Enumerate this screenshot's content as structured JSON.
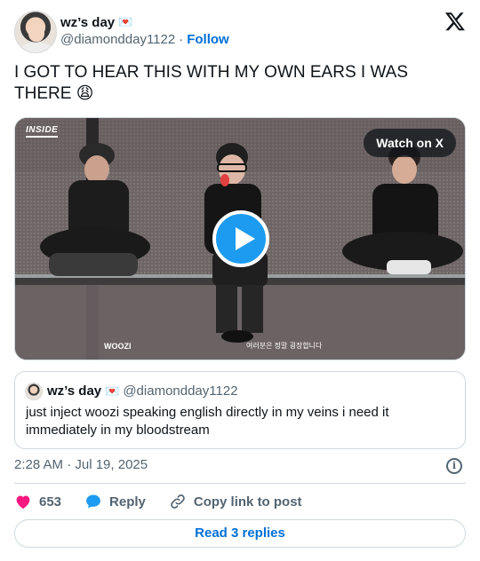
{
  "author": {
    "display_name": "wz’s day",
    "name_emoji": "💌",
    "handle": "@diamondday1122",
    "separator": "·",
    "follow_label": "Follow"
  },
  "tweet": {
    "text": "I GOT TO HEAR THIS WITH MY OWN EARS I WAS THERE 😩"
  },
  "media": {
    "watch_label": "Watch on X",
    "channel_logo": "INSIDE",
    "name_tag": "WOOZI",
    "subtitle": "여러분은 정말 굉장합니다"
  },
  "quote": {
    "display_name": "wz’s day",
    "name_emoji": "💌",
    "handle": "@diamondday1122",
    "text": "just inject woozi speaking english directly in my veins i need it immediately in my bloodstream"
  },
  "meta": {
    "timestamp": "2:28 AM · Jul 19, 2025"
  },
  "actions": {
    "like_count": "653",
    "reply_label": "Reply",
    "copy_label": "Copy link to post"
  },
  "footer": {
    "read_replies_label": "Read 3 replies"
  },
  "colors": {
    "link_blue": "#006fd6",
    "like_red": "#f91880",
    "play_blue": "#1d9bf0"
  }
}
